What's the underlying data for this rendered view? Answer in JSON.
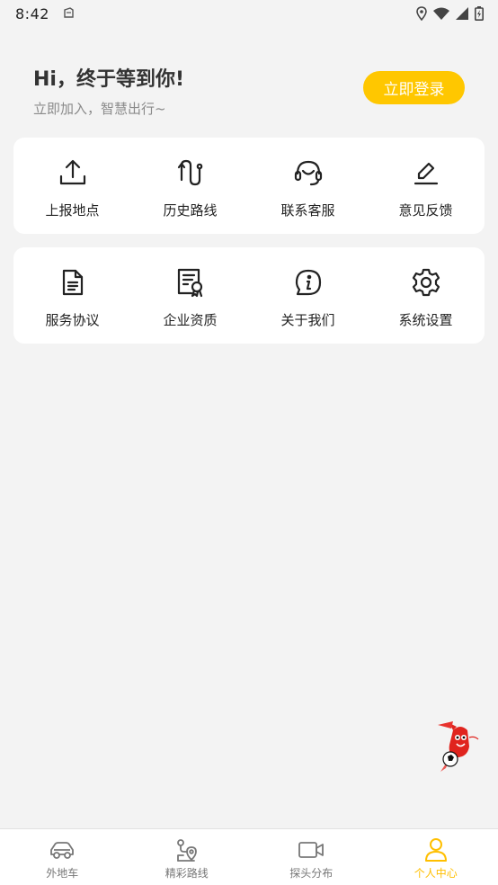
{
  "status_bar": {
    "time": "8:42"
  },
  "header": {
    "greeting": "Hi，终于等到你!",
    "subtitle": "立即加入，智慧出行~",
    "login_label": "立即登录"
  },
  "grid_row1": [
    {
      "label": "上报地点",
      "icon": "upload-icon"
    },
    {
      "label": "历史路线",
      "icon": "route-history-icon"
    },
    {
      "label": "联系客服",
      "icon": "headset-icon"
    },
    {
      "label": "意见反馈",
      "icon": "edit-pen-icon"
    }
  ],
  "grid_row2": [
    {
      "label": "服务协议",
      "icon": "document-icon"
    },
    {
      "label": "企业资质",
      "icon": "certificate-icon"
    },
    {
      "label": "关于我们",
      "icon": "info-icon"
    },
    {
      "label": "系统设置",
      "icon": "gear-icon"
    }
  ],
  "tabs": [
    {
      "label": "外地车",
      "icon": "car-icon",
      "active": false
    },
    {
      "label": "精彩路线",
      "icon": "map-route-icon",
      "active": false
    },
    {
      "label": "探头分布",
      "icon": "camera-icon",
      "active": false
    },
    {
      "label": "个人中心",
      "icon": "user-icon",
      "active": true
    }
  ],
  "colors": {
    "accent": "#ffc700",
    "background": "#f3f3f3",
    "active_tab": "#ffbf00"
  }
}
